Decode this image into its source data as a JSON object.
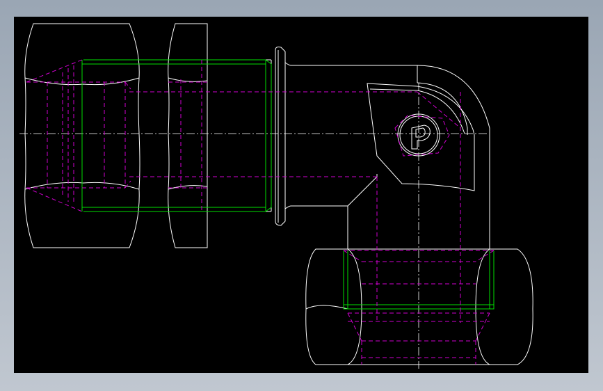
{
  "drawing": {
    "colors": {
      "background": "#000000",
      "outline": "#ffffff",
      "thread": "#00e000",
      "hidden": "#d000d0",
      "frame": "#9aa6b4"
    },
    "logo_icon": "brand-logo-icon"
  }
}
